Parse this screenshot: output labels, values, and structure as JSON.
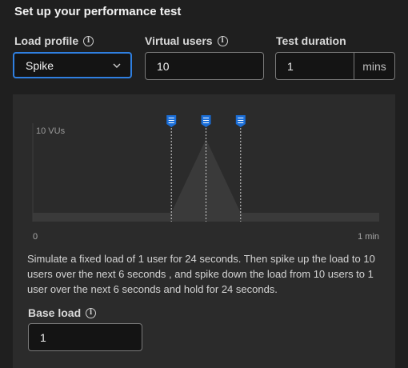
{
  "page": {
    "title": "Set up your performance test"
  },
  "load_profile": {
    "label": "Load profile",
    "value": "Spike"
  },
  "virtual_users": {
    "label": "Virtual users",
    "value": "10"
  },
  "test_duration": {
    "label": "Test duration",
    "value": "1",
    "unit": "mins"
  },
  "chart": {
    "y_label": "10 VUs",
    "x_start": "0",
    "x_end": "1 min",
    "markers": [
      "spike-start",
      "spike-peak",
      "spike-end"
    ]
  },
  "chart_data": {
    "type": "area",
    "x_unit": "seconds",
    "xlim": [
      0,
      60
    ],
    "ylim": [
      0,
      10
    ],
    "x": [
      0,
      24,
      30,
      36,
      60
    ],
    "y": [
      1,
      1,
      10,
      1,
      1
    ],
    "tick_labels": [
      "0",
      "1 min"
    ],
    "y_tick_label": "10 VUs"
  },
  "description": "Simulate a fixed load of 1 user for 24 seconds. Then spike up the load to 10 users over the next 6 seconds , and spike down the load from 10 users to 1 user over the next 6 seconds and hold for 24 seconds.",
  "base_load": {
    "label": "Base load",
    "value": "1"
  },
  "colors": {
    "accent": "#2f7fe0",
    "panel": "#2b2b2b",
    "area": "#3a3a3a"
  }
}
